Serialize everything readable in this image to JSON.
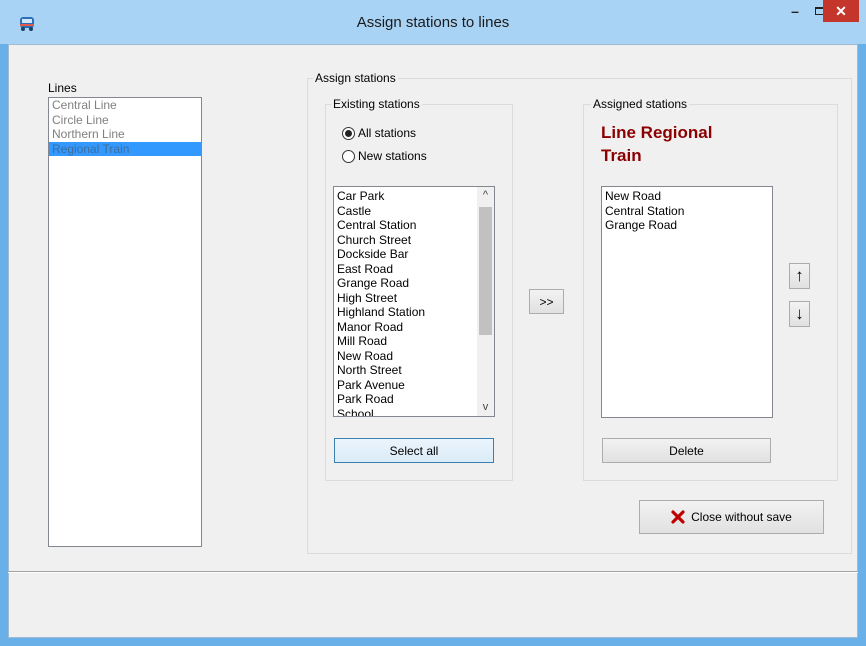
{
  "window": {
    "title": "Assign stations to lines",
    "min_glyph": "–",
    "close_glyph": "✕"
  },
  "lines": {
    "label": "Lines",
    "items": [
      "Central Line",
      "Circle Line",
      "Northern Line",
      "Regional Train"
    ],
    "selected_index": 3
  },
  "assign": {
    "group_title": "Assign stations",
    "existing": {
      "group_title": "Existing stations",
      "radio_all": "All stations",
      "radio_new": "New stations",
      "selected_radio": "all",
      "items": [
        "Car Park",
        "Castle",
        "Central Station",
        "Church Street",
        "Dockside Bar",
        "East Road",
        "Grange Road",
        "High Street",
        "Highland Station",
        "Manor Road",
        "Mill Road",
        "New Road",
        "North Street",
        "Park Avenue",
        "Park Road",
        "School"
      ],
      "select_all_label": "Select all",
      "scroll_up_glyph": "^",
      "scroll_down_glyph": "v"
    },
    "transfer_label": ">>",
    "assigned": {
      "group_title": "Assigned stations",
      "line_title": "Line Regional Train",
      "items": [
        "New Road",
        "Central Station",
        "Grange Road"
      ],
      "delete_label": "Delete",
      "up_glyph": "↑",
      "down_glyph": "↓"
    },
    "close_label": "Close without save"
  },
  "colors": {
    "accent": "#3399ff",
    "line_title": "#8b0000",
    "close_icon": "#c00000",
    "titlebar": "#a9d3f5"
  }
}
